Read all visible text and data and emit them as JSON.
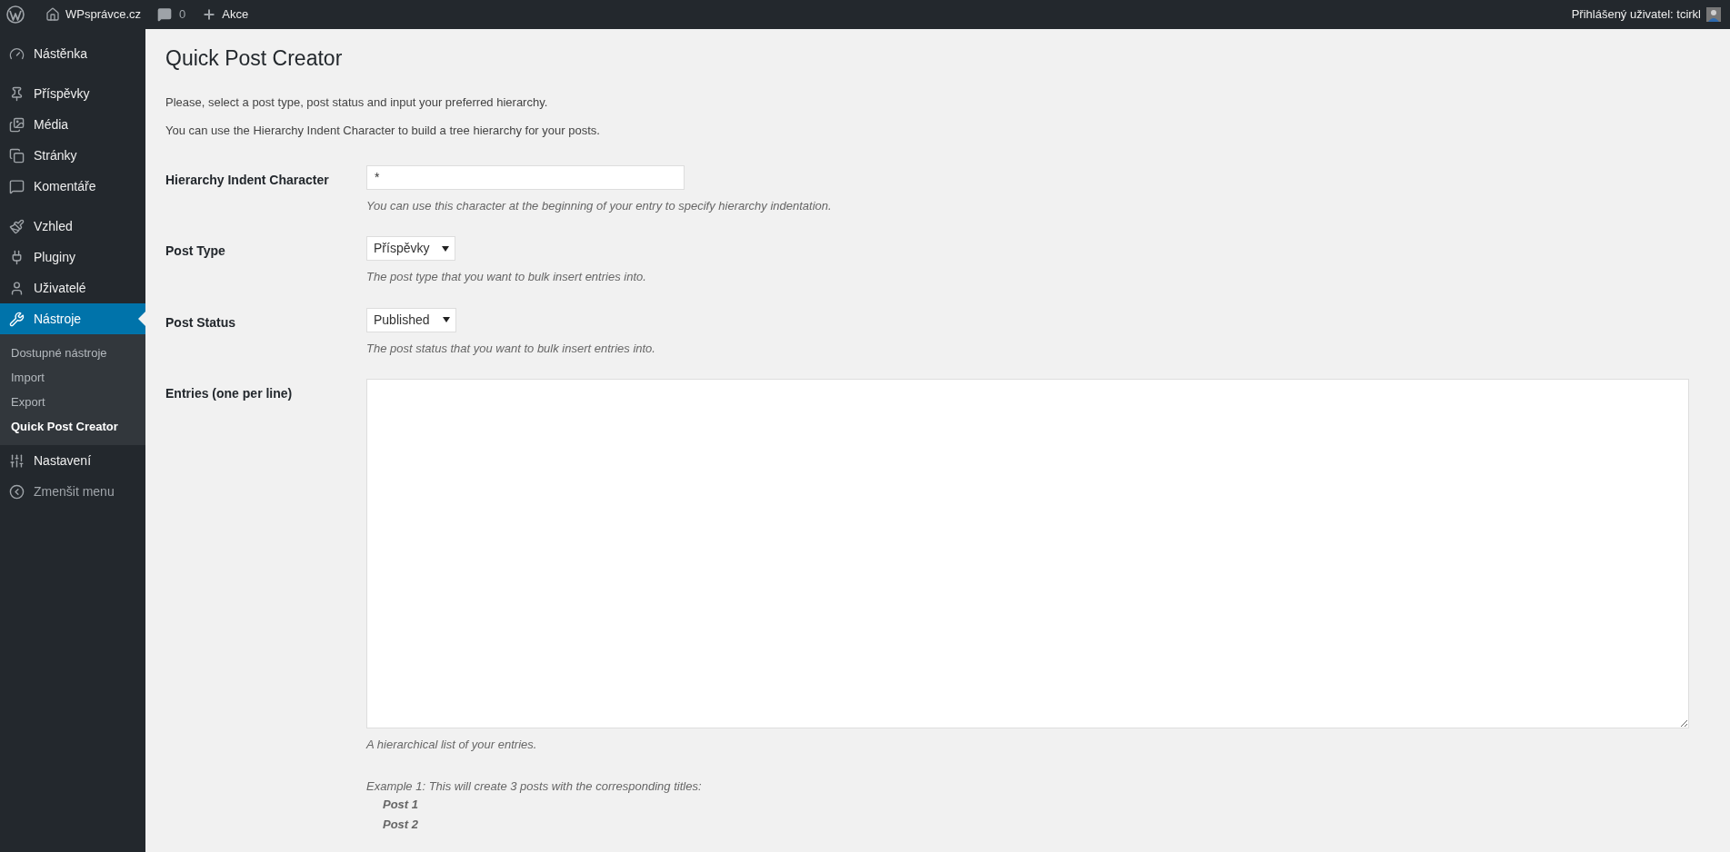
{
  "admin_bar": {
    "site": "WPsprávce.cz",
    "comments": "0",
    "new": "Akce",
    "account": "Přihlášený uživatel: tcirkl"
  },
  "sidebar": {
    "groups": [
      {
        "items": [
          {
            "kind": "gauge",
            "label": "Nástěnka",
            "selected": false
          }
        ]
      },
      {
        "items": [
          {
            "kind": "pin",
            "label": "Příspěvky",
            "selected": false
          },
          {
            "kind": "media",
            "label": "Média",
            "selected": false
          },
          {
            "kind": "pages",
            "label": "Stránky",
            "selected": false
          },
          {
            "kind": "comment",
            "label": "Komentáře",
            "selected": false
          }
        ]
      },
      {
        "items": [
          {
            "kind": "brush",
            "label": "Vzhled",
            "selected": false
          },
          {
            "kind": "plug",
            "label": "Pluginy",
            "selected": false
          },
          {
            "kind": "user",
            "label": "Uživatelé",
            "selected": false
          },
          {
            "kind": "wrench",
            "label": "Nástroje",
            "selected": true,
            "children": [
              {
                "label": "Dostupné nástroje",
                "selected": false
              },
              {
                "label": "Import",
                "selected": false
              },
              {
                "label": "Export",
                "selected": false
              },
              {
                "label": "Quick Post Creator",
                "selected": true
              }
            ]
          },
          {
            "kind": "sliders",
            "label": "Nastavení",
            "selected": false
          },
          {
            "kind": "collapse",
            "label": "Zmenšit menu",
            "selected": false
          }
        ]
      }
    ]
  },
  "page": {
    "title": "Quick Post Creator",
    "intro": [
      "Please, select a post type, post status and input your preferred hierarchy.",
      "You can use the Hierarchy Indent Character to build a tree hierarchy for your posts."
    ],
    "fields": [
      {
        "kind": "text",
        "label": "Hierarchy Indent Character",
        "value": "*",
        "hint": "You can use this character at the beginning of your entry to specify hierarchy indentation."
      },
      {
        "kind": "select",
        "label": "Post Type",
        "value": "Příspěvky",
        "hint": "The post type that you want to bulk insert entries into."
      },
      {
        "kind": "select",
        "label": "Post Status",
        "value": "Published",
        "hint": "The post status that you want to bulk insert entries into."
      },
      {
        "kind": "textarea",
        "label": "Entries (one per line)",
        "hint": "A hierarchical list of your entries."
      }
    ],
    "example": {
      "text": "Example 1: This will create 3 posts with the corresponding titles:",
      "lines": [
        "Post 1",
        "Post 2"
      ]
    }
  }
}
